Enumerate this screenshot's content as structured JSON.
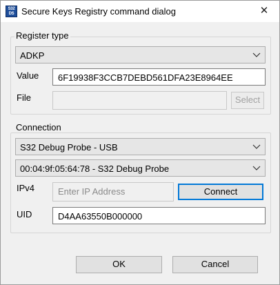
{
  "window": {
    "title": "Secure Keys Registry command dialog",
    "icon_text": "S32\nDS",
    "close_glyph": "✕"
  },
  "register_type": {
    "legend": "Register type",
    "selected": "ADKP",
    "value_label": "Value",
    "value": "6F19938F3CCB7DEBD561DFA23E8964EE",
    "file_label": "File",
    "file_value": "",
    "select_button": "Select"
  },
  "connection": {
    "legend": "Connection",
    "probe_type": "S32 Debug Probe - USB",
    "probe_device": "00:04:9f:05:64:78 - S32 Debug Probe",
    "ipv4_label": "IPv4",
    "ipv4_placeholder": "Enter IP Address",
    "connect_button": "Connect",
    "uid_label": "UID",
    "uid_value": "D4AA63550B000000"
  },
  "footer": {
    "ok_button": "OK",
    "cancel_button": "Cancel"
  }
}
